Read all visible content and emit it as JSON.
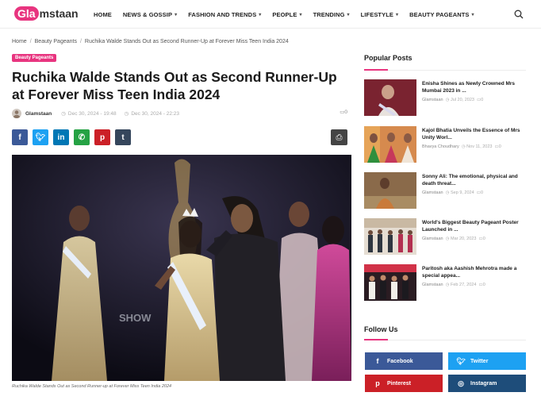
{
  "header": {
    "logo_badge": "Gla",
    "logo_rest": "mstaan",
    "nav": [
      {
        "label": "HOME",
        "dropdown": false
      },
      {
        "label": "NEWS & GOSSIP",
        "dropdown": true
      },
      {
        "label": "FASHION AND TRENDS",
        "dropdown": true
      },
      {
        "label": "PEOPLE",
        "dropdown": true
      },
      {
        "label": "TRENDING",
        "dropdown": true
      },
      {
        "label": "LIFESTYLE",
        "dropdown": true
      },
      {
        "label": "BEAUTY PAGEANTS",
        "dropdown": true
      }
    ]
  },
  "breadcrumb": [
    "Home",
    "Beauty Pageants",
    "Ruchika Walde Stands Out as Second Runner-Up at Forever Miss Teen India 2024"
  ],
  "article": {
    "category": "Beauty Pageants",
    "title": "Ruchika Walde Stands Out as Second Runner-Up at Forever Miss Teen India 2024",
    "author": "Glamstaan",
    "published": "Dec 30, 2024 - 19:48",
    "updated": "Dec 30, 2024 - 22:23",
    "comments": "0",
    "caption": "Ruchika Walde Stands Out as Second Runner-up at Forever Miss Teen India 2024"
  },
  "share": [
    {
      "icon": "facebook-icon",
      "glyph": "f",
      "color": "#3b5998"
    },
    {
      "icon": "twitter-icon",
      "glyph": "t",
      "color": "#1da1f2"
    },
    {
      "icon": "linkedin-icon",
      "glyph": "in",
      "color": "#0077b5"
    },
    {
      "icon": "whatsapp-icon",
      "glyph": "w",
      "color": "#25a244"
    },
    {
      "icon": "pinterest-icon",
      "glyph": "p",
      "color": "#cb2027"
    },
    {
      "icon": "tumblr-icon",
      "glyph": "t",
      "color": "#35465c"
    }
  ],
  "sidebar": {
    "popular_title": "Popular Posts",
    "posts": [
      {
        "title": "Enisha Shines as Newly Crowned Mrs Mumbai 2023 in ...",
        "author": "Glamstaan",
        "date": "Jul 20, 2023",
        "comments": "0"
      },
      {
        "title": "Kajol Bhatia Unveils the Essence of Mrs Unity Worl...",
        "author": "Bhavya Choudhary",
        "date": "Nov 11, 2023",
        "comments": "0"
      },
      {
        "title": "Sonny Ali: The emotional, physical and death threat...",
        "author": "Glamstaan",
        "date": "Sep 9, 2024",
        "comments": "0"
      },
      {
        "title": "World's Biggest Beauty Pageant Poster Launched in ...",
        "author": "Glamstaan",
        "date": "Mar 20, 2023",
        "comments": "0"
      },
      {
        "title": "Paritosh aka Aashish Mehrotra made a special appea...",
        "author": "Glamstaan",
        "date": "Feb 27, 2024",
        "comments": "0"
      }
    ],
    "follow_title": "Follow Us",
    "follow": [
      {
        "label": "Facebook",
        "color": "#3b5998",
        "icon": "facebook-icon",
        "glyph": "f"
      },
      {
        "label": "Twitter",
        "color": "#1da1f2",
        "icon": "twitter-icon",
        "glyph": "t"
      },
      {
        "label": "Pinterest",
        "color": "#cb2027",
        "icon": "pinterest-icon",
        "glyph": "p"
      },
      {
        "label": "Instagram",
        "color": "#1e4d7a",
        "icon": "instagram-icon",
        "glyph": "◎"
      }
    ]
  },
  "colors": {
    "accent": "#e8347f"
  }
}
